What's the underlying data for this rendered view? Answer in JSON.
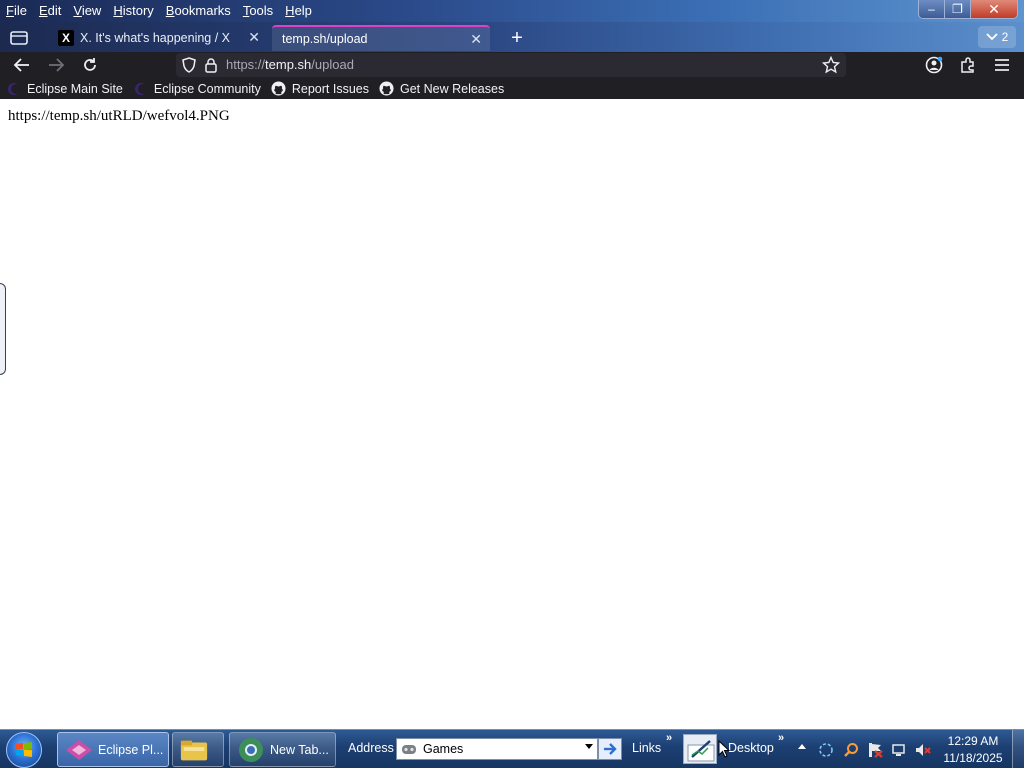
{
  "menu": {
    "items": [
      {
        "label": "File",
        "accel": "F",
        "rest": "ile"
      },
      {
        "label": "Edit",
        "accel": "E",
        "rest": "dit"
      },
      {
        "label": "View",
        "accel": "V",
        "rest": "iew"
      },
      {
        "label": "History",
        "accel": "H",
        "rest": "istory"
      },
      {
        "label": "Bookmarks",
        "accel": "B",
        "rest": "ookmarks"
      },
      {
        "label": "Tools",
        "accel": "T",
        "rest": "ools"
      },
      {
        "label": "Help",
        "accel": "H",
        "rest": "elp"
      }
    ]
  },
  "window_controls": {
    "minimize": "–",
    "restore": "❐",
    "close": "✕"
  },
  "tabs": [
    {
      "title": "X. It's what's happening / X",
      "favicon": "X",
      "active": false
    },
    {
      "title": "temp.sh/upload",
      "active": true
    }
  ],
  "tab_close_glyph": "✕",
  "new_tab_glyph": "+",
  "tab_overflow_count": "2",
  "urlbar": {
    "prefix": "https://",
    "host": "temp.sh",
    "path": "/upload"
  },
  "bookmarks": [
    {
      "label": "Eclipse Main Site",
      "icon": "eclipse-icon"
    },
    {
      "label": "Eclipse Community",
      "icon": "eclipse-icon"
    },
    {
      "label": "Report Issues",
      "icon": "github-icon"
    },
    {
      "label": "Get New Releases",
      "icon": "github-icon"
    }
  ],
  "page": {
    "text": "https://temp.sh/utRLD/wefvol4.PNG"
  },
  "taskbar": {
    "tasks": [
      {
        "label": "Eclipse Pl...",
        "icon": "eclipse-ide-icon",
        "active": true
      },
      {
        "label": "",
        "icon": "file-explorer-icon",
        "active": false
      },
      {
        "label": "New Tab...",
        "icon": "chrome-icon",
        "active": false
      }
    ],
    "address_label": "Address",
    "address_value": "Games",
    "links_label": "Links",
    "desktop_label": "Desktop",
    "chevron": "»",
    "clock_time": "12:29 AM",
    "clock_date": "11/18/2025"
  },
  "colors": {
    "accent_tab": "#e040c8",
    "browser_chrome": "#1f1f24",
    "taskbar": "#1c3f72"
  }
}
